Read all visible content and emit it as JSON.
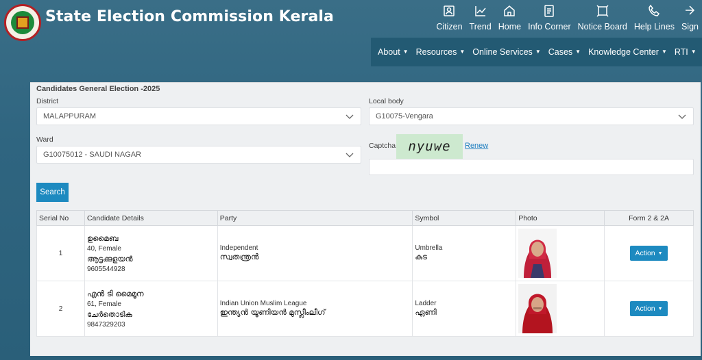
{
  "header": {
    "site_title": "State Election Commission Kerala",
    "top_links": [
      {
        "label": "Citizen",
        "icon": "citizen-icon"
      },
      {
        "label": "Trend",
        "icon": "trend-icon"
      },
      {
        "label": "Home",
        "icon": "home-icon"
      },
      {
        "label": "Info Corner",
        "icon": "info-corner-icon"
      },
      {
        "label": "Notice Board",
        "icon": "notice-board-icon"
      },
      {
        "label": "Help Lines",
        "icon": "phone-icon"
      },
      {
        "label": "Sign",
        "icon": "sign-icon"
      }
    ],
    "menu": [
      "About",
      "Resources",
      "Online Services",
      "Cases",
      "Knowledge Center",
      "RTI"
    ]
  },
  "form": {
    "title": "Candidates General Election -2025",
    "district_label": "District",
    "district_value": "MALAPPURAM",
    "local_body_label": "Local body",
    "local_body_value": "G10075-Vengara",
    "ward_label": "Ward",
    "ward_value": "G10075012 - SAUDI NAGAR",
    "captcha_label": "Captcha",
    "captcha_text": "nyuwe",
    "renew_label": "Renew",
    "search_label": "Search"
  },
  "table": {
    "headers": [
      "Serial No",
      "Candidate Details",
      "Party",
      "Symbol",
      "Photo",
      "Form 2 & 2A"
    ],
    "rows": [
      {
        "serial": "1",
        "name": "ഉമൈബ",
        "age_gender": "40, Female",
        "address": "ആട്ടക്കുളയൻ",
        "phone": "9605544928",
        "party_en": "Independent",
        "party_ml": "സ്വതന്ത്രൻ",
        "symbol_en": "Umbrella",
        "symbol_ml": "കുട",
        "action": "Action"
      },
      {
        "serial": "2",
        "name": "എൻ ടി മൈമൂന",
        "age_gender": "61, Female",
        "address": "ചേർതൊടിക",
        "phone": "9847329203",
        "party_en": "Indian Union Muslim League",
        "party_ml": "ഇന്ത്യൻ യൂണിയൻ മുസ്ലീംലീഗ്",
        "symbol_en": "Ladder",
        "symbol_ml": "ഏണി",
        "action": "Action"
      }
    ]
  },
  "colors": {
    "background": "#2f6580",
    "menu_bar": "#235a73",
    "button": "#1d8ac0",
    "captcha_bg": "#cde9cf"
  }
}
